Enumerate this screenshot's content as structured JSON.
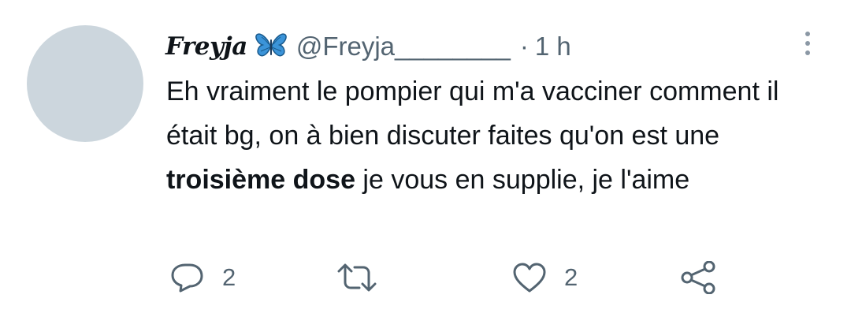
{
  "tweet": {
    "display_name": "Freyja",
    "name_emoji": "butterfly-icon",
    "handle": "@Freyja________",
    "separator": "·",
    "time": "1 h",
    "text_part1": "Eh vraiment le pompier qui m'a vacciner comment il était bg, on à bien discuter faites qu'on est une ",
    "text_bold": "troisième dose",
    "text_part2": " je vous en supplie, je l'aime"
  },
  "actions": {
    "reply_count": "2",
    "retweet_count": "",
    "like_count": "2"
  },
  "colors": {
    "avatar_placeholder": "#ccd6dd",
    "secondary_text": "#536471",
    "primary_text": "#0f1419",
    "butterfly": "#3b94d9"
  }
}
